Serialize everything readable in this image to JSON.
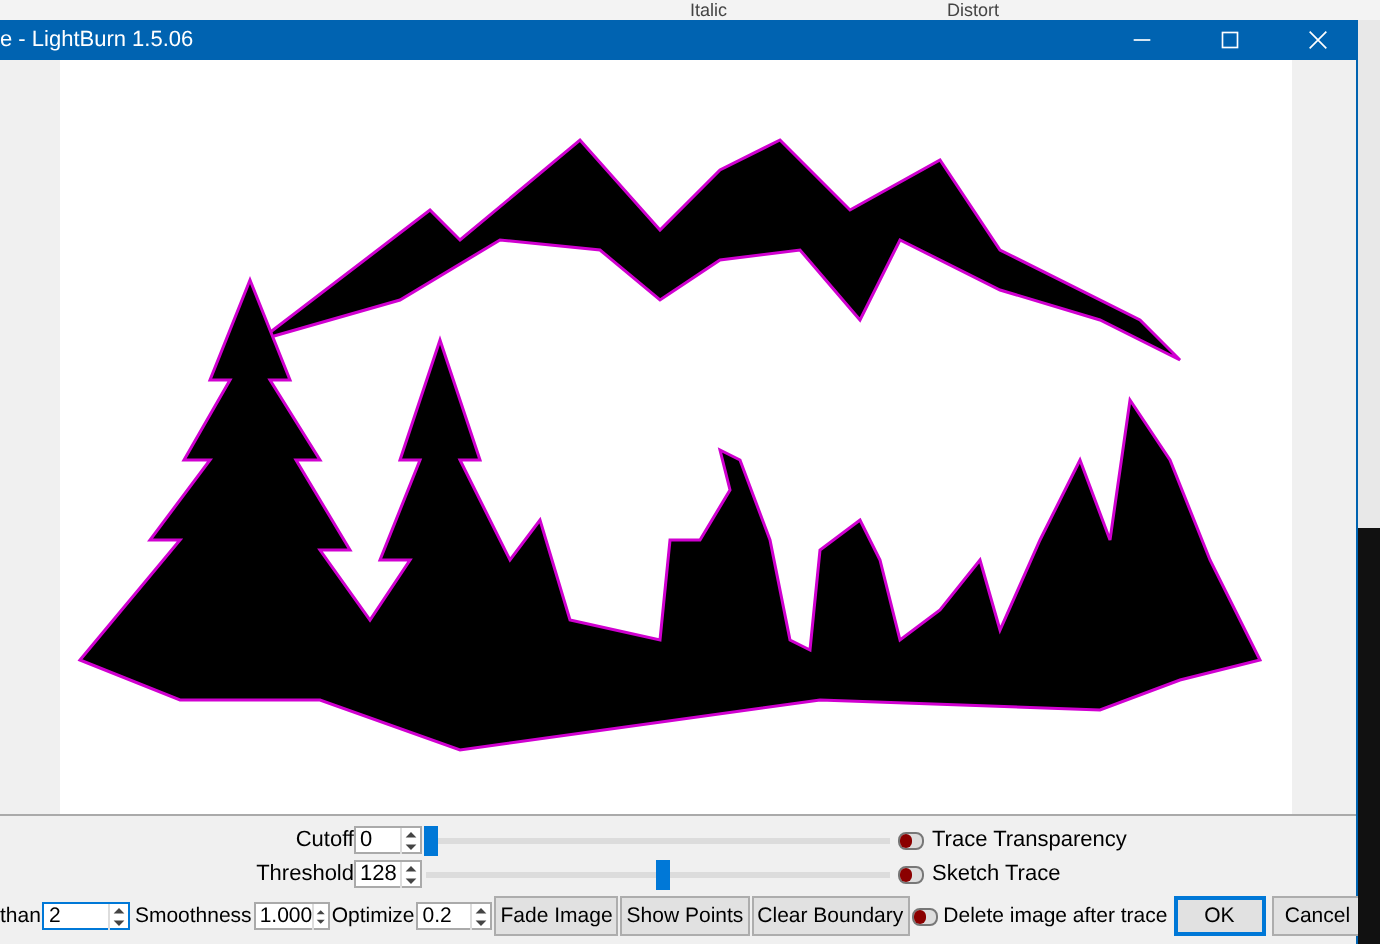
{
  "background_app": {
    "items": [
      "Italic",
      "Distort"
    ]
  },
  "window": {
    "title": "e - LightBurn 1.5.06"
  },
  "sliders": [
    {
      "label": "Cutoff",
      "value": "0",
      "level": 0.0,
      "toggle": {
        "label": "Trace Transparency",
        "checked": false
      }
    },
    {
      "label": "Threshold",
      "value": "128",
      "level": 0.5,
      "toggle": {
        "label": "Sketch Trace",
        "checked": false
      }
    }
  ],
  "options": [
    {
      "kind": "spin",
      "label": "than",
      "value": "2",
      "focused": true
    },
    {
      "kind": "spin",
      "label": "Smoothness",
      "value": "1.000",
      "focused": false
    },
    {
      "kind": "spin",
      "label": "Optimize",
      "value": "0.2",
      "focused": false
    },
    {
      "kind": "button",
      "label": "Fade Image"
    },
    {
      "kind": "button",
      "label": "Show Points"
    },
    {
      "kind": "button",
      "label": "Clear Boundary"
    },
    {
      "kind": "toggle",
      "label": "Delete image after trace",
      "checked": false
    }
  ],
  "buttons": [
    {
      "label": "OK",
      "default": true
    },
    {
      "label": "Cancel",
      "default": false
    }
  ]
}
